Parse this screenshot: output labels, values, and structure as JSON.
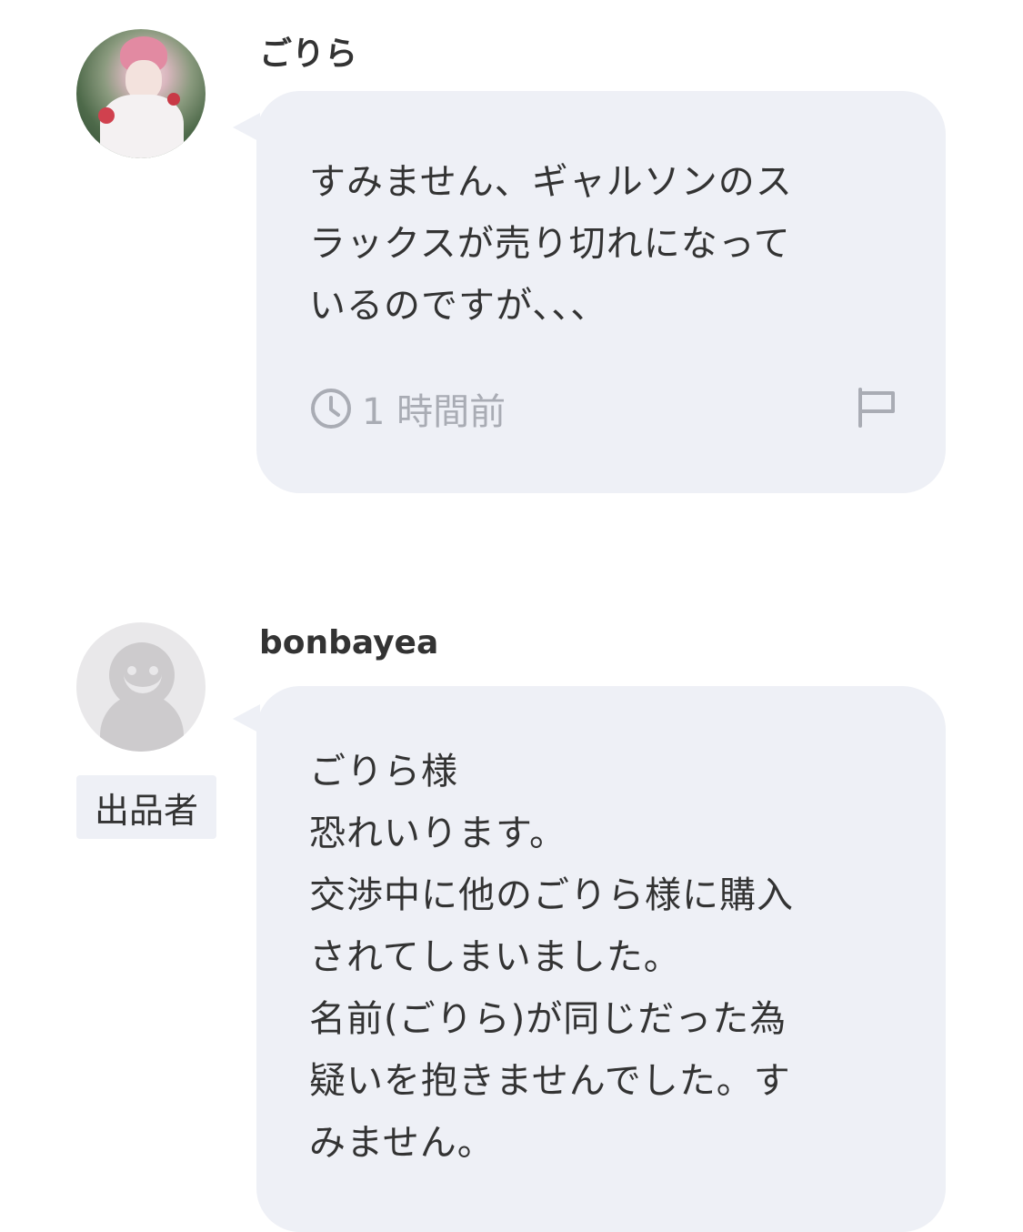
{
  "comments": [
    {
      "username": "ごりら",
      "message": "すみません、ギャルソンのス\nラックスが売り切れになって\nいるのですが、、、",
      "time": "1 時間前",
      "avatar_icon": "user-photo",
      "report_icon": "flag-icon",
      "time_icon": "clock-icon"
    },
    {
      "username": "bonbayea",
      "badge": "出品者",
      "message": "ごりら様\n恐れいります。\n交渉中に他のごりら様に購入\nされてしまいました。\n名前(ごりら)が同じだった為\n疑いを抱きませんでした。す\nみません。",
      "avatar_icon": "default-avatar"
    }
  ],
  "colors": {
    "bubble": "#eef0f6",
    "text": "#333333",
    "meta_text": "#a9acb4",
    "avatar_default": "#cdcbcd"
  }
}
